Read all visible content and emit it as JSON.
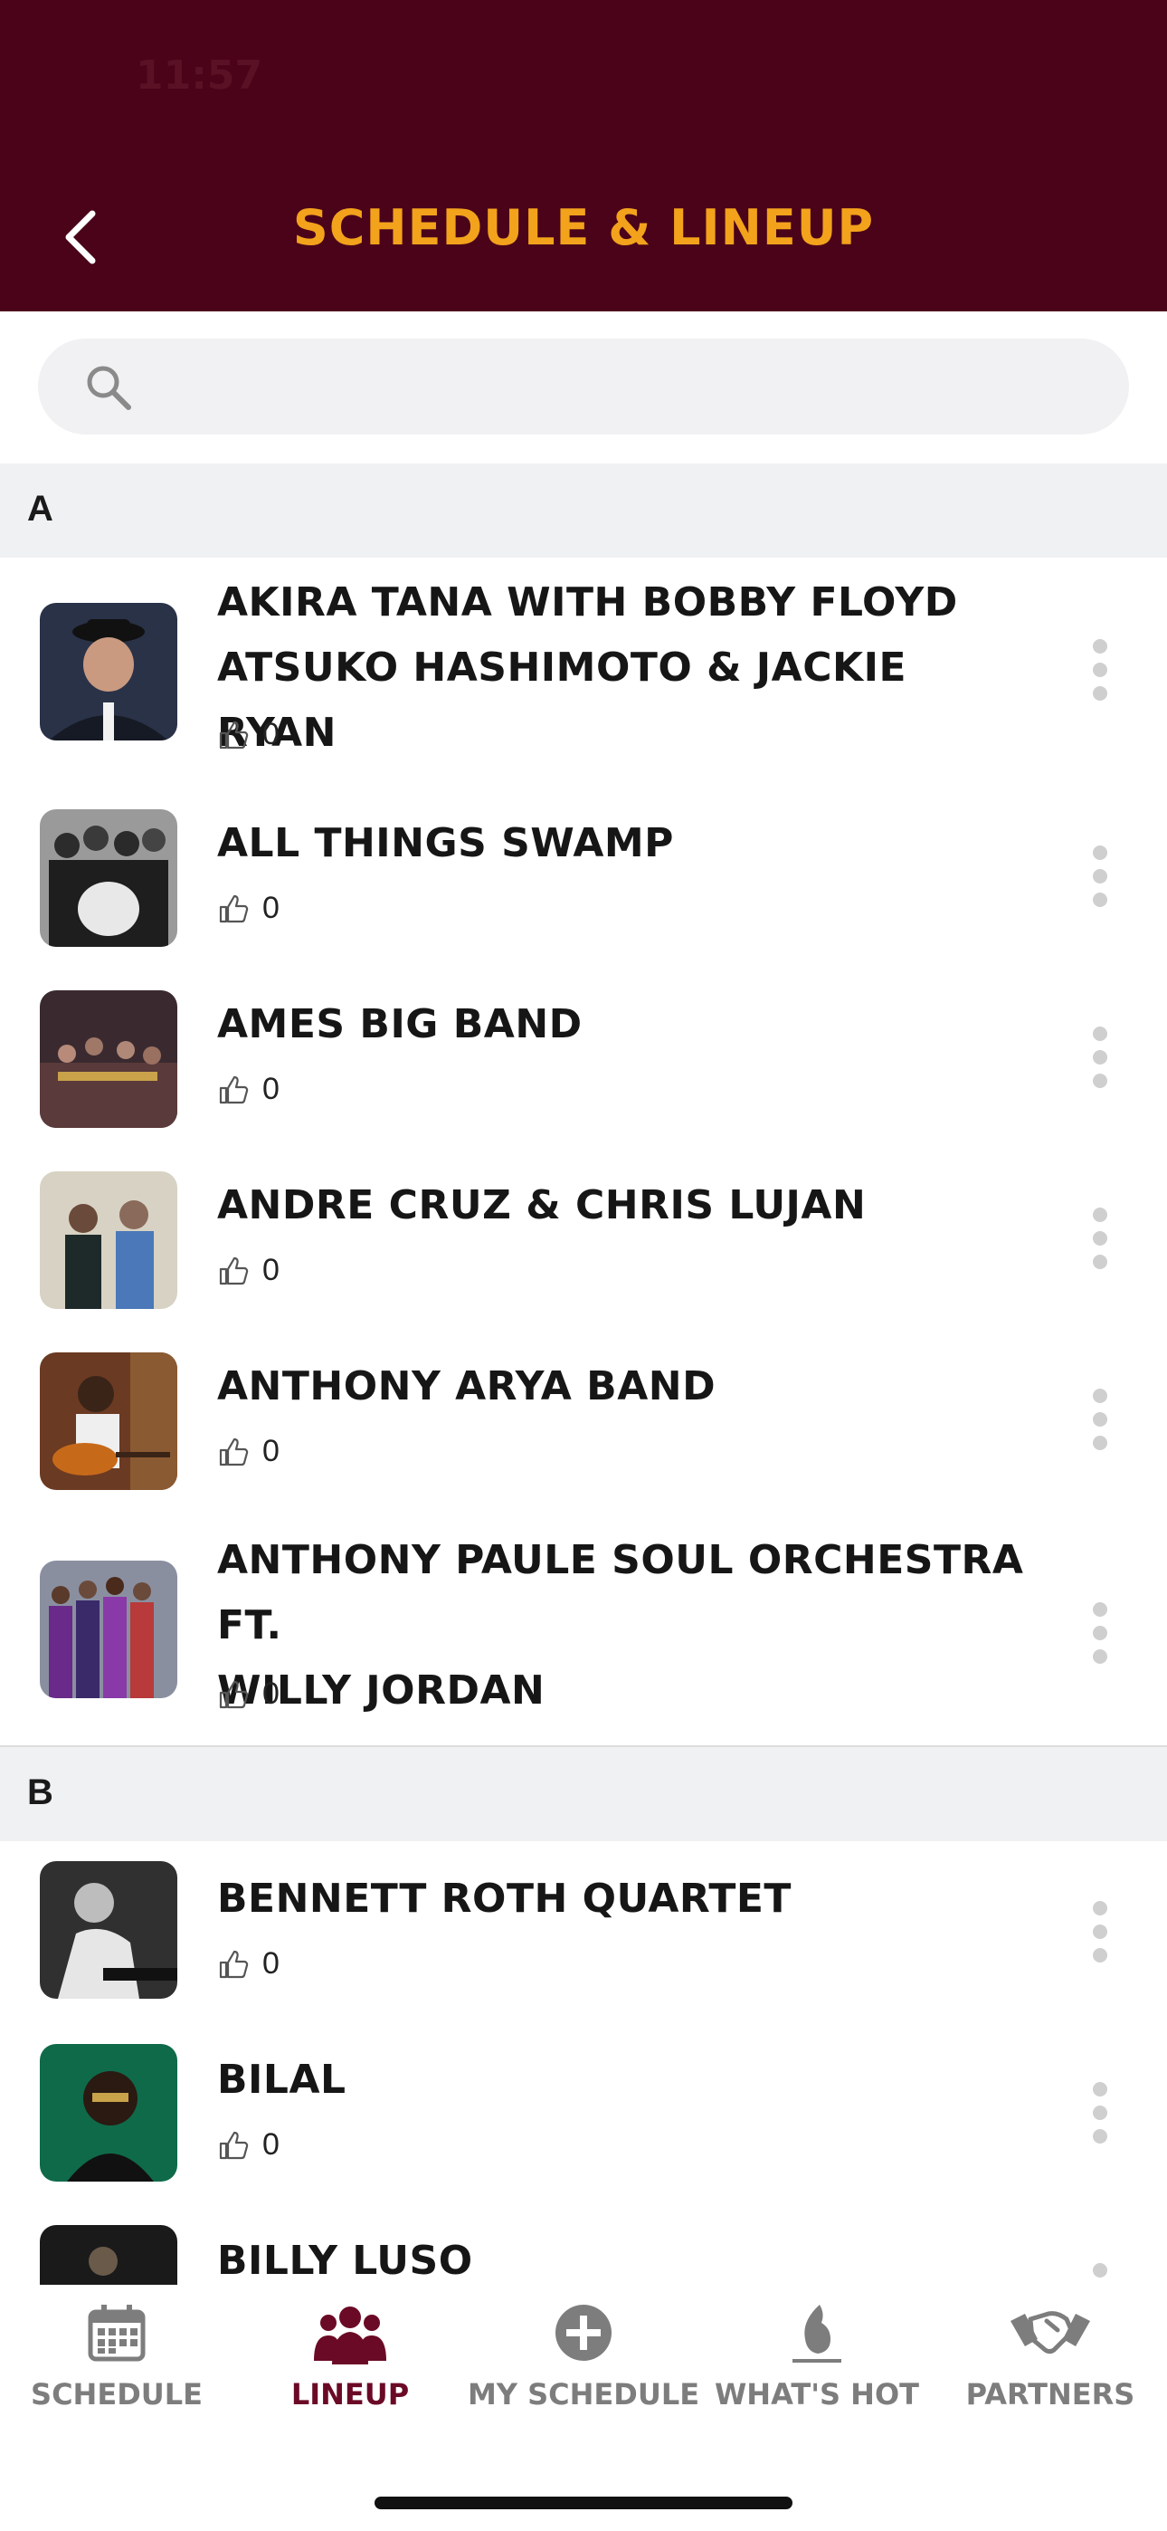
{
  "status": {
    "time": "11:57"
  },
  "header": {
    "title": "SCHEDULE & LINEUP"
  },
  "search": {
    "placeholder": ""
  },
  "sections": [
    {
      "letter": "A"
    },
    {
      "letter": "B"
    }
  ],
  "artists": [
    {
      "name_lines": [
        "AKIRA TANA WITH BOBBY FLOYD",
        "ATSUKO HASHIMOTO & JACKIE RYAN"
      ],
      "likes": "0"
    },
    {
      "name_lines": [
        "ALL THINGS SWAMP"
      ],
      "likes": "0"
    },
    {
      "name_lines": [
        "AMES BIG BAND"
      ],
      "likes": "0"
    },
    {
      "name_lines": [
        "ANDRE CRUZ & CHRIS LUJAN"
      ],
      "likes": "0"
    },
    {
      "name_lines": [
        "ANTHONY ARYA BAND"
      ],
      "likes": "0"
    },
    {
      "name_lines": [
        "ANTHONY PAULE SOUL ORCHESTRA FT.",
        "WILLY JORDAN"
      ],
      "likes": "0"
    },
    {
      "name_lines": [
        "BENNETT ROTH QUARTET"
      ],
      "likes": "0"
    },
    {
      "name_lines": [
        "BILAL"
      ],
      "likes": "0"
    },
    {
      "name_lines": [
        "BILLY LUSO"
      ],
      "likes": ""
    }
  ],
  "tabs": [
    {
      "label": "SCHEDULE",
      "icon": "calendar-icon",
      "active": false
    },
    {
      "label": "LINEUP",
      "icon": "group-icon",
      "active": true
    },
    {
      "label": "MY SCHEDULE",
      "icon": "plus-circle-icon",
      "active": false
    },
    {
      "label": "WHAT'S HOT",
      "icon": "flame-icon",
      "active": false
    },
    {
      "label": "PARTNERS",
      "icon": "handshake-icon",
      "active": false
    }
  ],
  "colors": {
    "header_bg": "#4a0318",
    "title": "#f3a21c",
    "active_tab": "#6b0a26",
    "inactive_tab": "#7d7d7d"
  }
}
